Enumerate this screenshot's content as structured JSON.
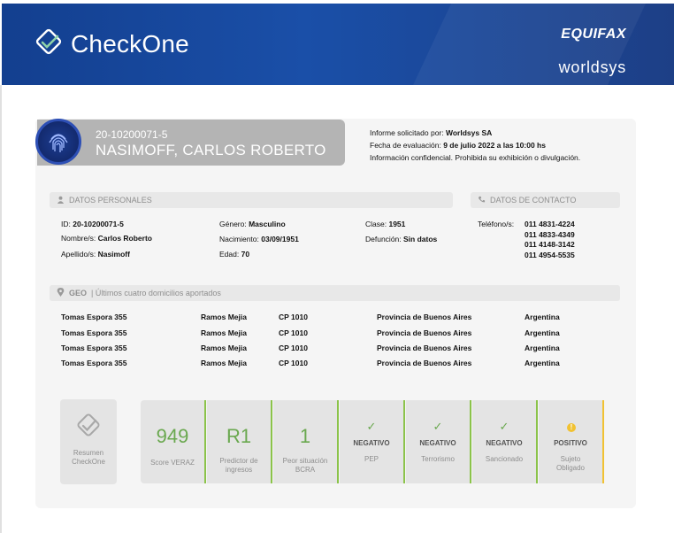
{
  "header": {
    "app_title": "CheckOne",
    "brand_primary": "EQUIFAX",
    "brand_secondary": "worldsys"
  },
  "person": {
    "cuit": "20-10200071-5",
    "full_name": "NASIMOFF, CARLOS ROBERTO"
  },
  "report": {
    "requested_by_label": "Informe solicitado por:",
    "requested_by": "Worldsys SA",
    "eval_date_label": "Fecha de evaluación:",
    "eval_date": "9 de julio 2022 a las 10:00 hs",
    "confidential": "Información confidencial. Prohibida su exhibición o divulgación."
  },
  "personal": {
    "section_title": "DATOS PERSONALES",
    "id_label": "ID:",
    "id": "20-10200071-5",
    "nombres_label": "Nombre/s:",
    "nombres": "Carlos Roberto",
    "apellidos_label": "Apellido/s:",
    "apellidos": "Nasimoff",
    "genero_label": "Género:",
    "genero": "Masculino",
    "nacimiento_label": "Nacimiento:",
    "nacimiento": "03/09/1951",
    "edad_label": "Edad:",
    "edad": "70",
    "clase_label": "Clase:",
    "clase": "1951",
    "defuncion_label": "Defunción:",
    "defuncion": "Sin datos"
  },
  "contact": {
    "section_title": "DATOS DE CONTACTO",
    "phones_label": "Teléfono/s:",
    "phones": [
      "011 4831-4224",
      "011 4833-4349",
      "011 4148-3142",
      "011 4954-5535"
    ]
  },
  "geo": {
    "section_title": "GEO",
    "section_subtitle": "| Últimos cuatro domicilios aportados",
    "addresses": [
      {
        "street": "Tomas Espora 355",
        "city": "Ramos Mejia",
        "cp": "CP 1010",
        "province": "Provincia de Buenos Aires",
        "country": "Argentina"
      },
      {
        "street": "Tomas Espora 355",
        "city": "Ramos Mejia",
        "cp": "CP 1010",
        "province": "Provincia de Buenos Aires",
        "country": "Argentina"
      },
      {
        "street": "Tomas Espora 355",
        "city": "Ramos Mejia",
        "cp": "CP 1010",
        "province": "Provincia de Buenos Aires",
        "country": "Argentina"
      },
      {
        "street": "Tomas Espora 355",
        "city": "Ramos Mejia",
        "cp": "CP 1010",
        "province": "Provincia de Buenos Aires",
        "country": "Argentina"
      }
    ]
  },
  "summary": {
    "resumen_label_1": "Resumen",
    "resumen_label_2": "CheckOne",
    "score_value": "949",
    "score_label": "Score VERAZ",
    "predictor_value": "R1",
    "predictor_label_1": "Predictor de",
    "predictor_label_2": "ingresos",
    "bcra_value": "1",
    "bcra_label_1": "Peor situación",
    "bcra_label_2": "BCRA",
    "pep_status": "NEGATIVO",
    "pep_label": "PEP",
    "terror_status": "NEGATIVO",
    "terror_label": "Terrorismo",
    "sanc_status": "NEGATIVO",
    "sanc_label": "Sancionado",
    "oblig_status": "POSITIVO",
    "oblig_label_1": "Sujeto",
    "oblig_label_2": "Obligado"
  },
  "colors": {
    "header_blue": "#1a4fa8",
    "positive_green": "#6aa84f",
    "warning_yellow": "#f1c232"
  },
  "icons": [
    "checkone-logo-icon",
    "fingerprint-icon",
    "user-icon",
    "phone-icon",
    "location-pin-icon",
    "checkmark-icon",
    "warning-icon"
  ]
}
